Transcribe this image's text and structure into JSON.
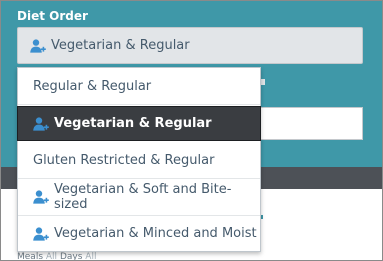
{
  "form": {
    "diet_label": "Diet Order",
    "selected_value": "Vegetarian & Regular",
    "footer_meals_label": "Meals",
    "footer_all_1": "All",
    "footer_days_label": "Days",
    "footer_all_2": "All"
  },
  "dropdown": {
    "options": [
      {
        "label": "Regular & Regular",
        "icon": ""
      },
      {
        "label": "Vegetarian & Regular",
        "icon": "user-icon",
        "selected": true
      },
      {
        "label": "Gluten Restricted & Regular",
        "icon": ""
      },
      {
        "label": "Vegetarian & Soft and Bite-sized",
        "icon": "user-icon"
      },
      {
        "label": "Vegetarian & Minced and Moist",
        "icon": "user-icon"
      }
    ]
  },
  "colors": {
    "accent": "#3f98a8",
    "selected_bg": "#3a3d41",
    "icon_blue": "#3b8fcf",
    "text": "#455a6c"
  }
}
